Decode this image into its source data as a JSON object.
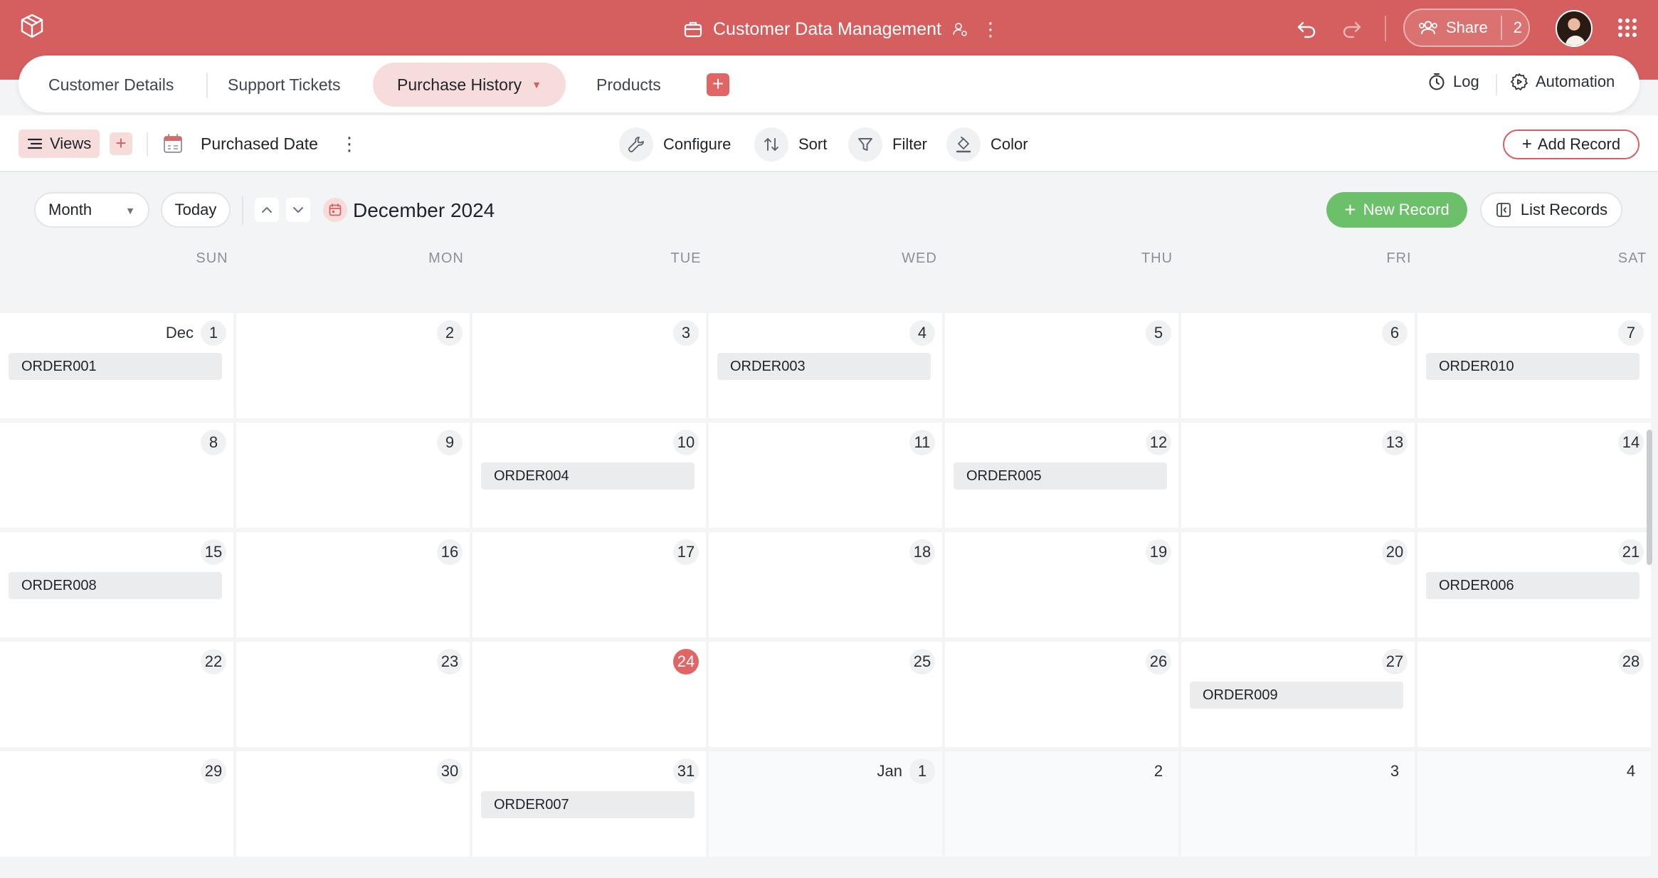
{
  "header": {
    "title": "Customer Data Management",
    "share_label": "Share",
    "share_count": "2"
  },
  "tabs": {
    "items": [
      {
        "label": "Customer Details"
      },
      {
        "label": "Support Tickets"
      },
      {
        "label": "Purchase History"
      },
      {
        "label": "Products"
      }
    ],
    "log_label": "Log",
    "automation_label": "Automation"
  },
  "toolbar": {
    "views_label": "Views",
    "view_name": "Purchased Date",
    "configure_label": "Configure",
    "sort_label": "Sort",
    "filter_label": "Filter",
    "color_label": "Color",
    "add_record_label": "Add Record"
  },
  "calendar": {
    "mode": "Month",
    "today_label": "Today",
    "title": "December 2024",
    "new_record_label": "New Record",
    "list_records_label": "List Records",
    "weekdays": [
      "SUN",
      "MON",
      "TUE",
      "WED",
      "THU",
      "FRI",
      "SAT"
    ],
    "cells": [
      {
        "day": "1",
        "month": "Dec",
        "event": "ORDER001"
      },
      {
        "day": "2"
      },
      {
        "day": "3"
      },
      {
        "day": "4",
        "event": "ORDER003"
      },
      {
        "day": "5"
      },
      {
        "day": "6"
      },
      {
        "day": "7",
        "event": "ORDER010"
      },
      {
        "day": "8"
      },
      {
        "day": "9"
      },
      {
        "day": "10",
        "event": "ORDER004"
      },
      {
        "day": "11"
      },
      {
        "day": "12",
        "event": "ORDER005"
      },
      {
        "day": "13"
      },
      {
        "day": "14"
      },
      {
        "day": "15",
        "event": "ORDER008"
      },
      {
        "day": "16"
      },
      {
        "day": "17"
      },
      {
        "day": "18"
      },
      {
        "day": "19"
      },
      {
        "day": "20"
      },
      {
        "day": "21",
        "event": "ORDER006"
      },
      {
        "day": "22"
      },
      {
        "day": "23"
      },
      {
        "day": "24",
        "today": true
      },
      {
        "day": "25"
      },
      {
        "day": "26"
      },
      {
        "day": "27",
        "event": "ORDER009"
      },
      {
        "day": "28"
      },
      {
        "day": "29"
      },
      {
        "day": "30"
      },
      {
        "day": "31",
        "event": "ORDER007"
      },
      {
        "day": "1",
        "month": "Jan",
        "outside": true
      },
      {
        "day": "2",
        "outside": true
      },
      {
        "day": "3",
        "outside": true
      },
      {
        "day": "4",
        "outside": true
      }
    ]
  },
  "colors": {
    "brand": "#d55f5f",
    "new_record": "#6cc06a",
    "today": "#e06666"
  }
}
